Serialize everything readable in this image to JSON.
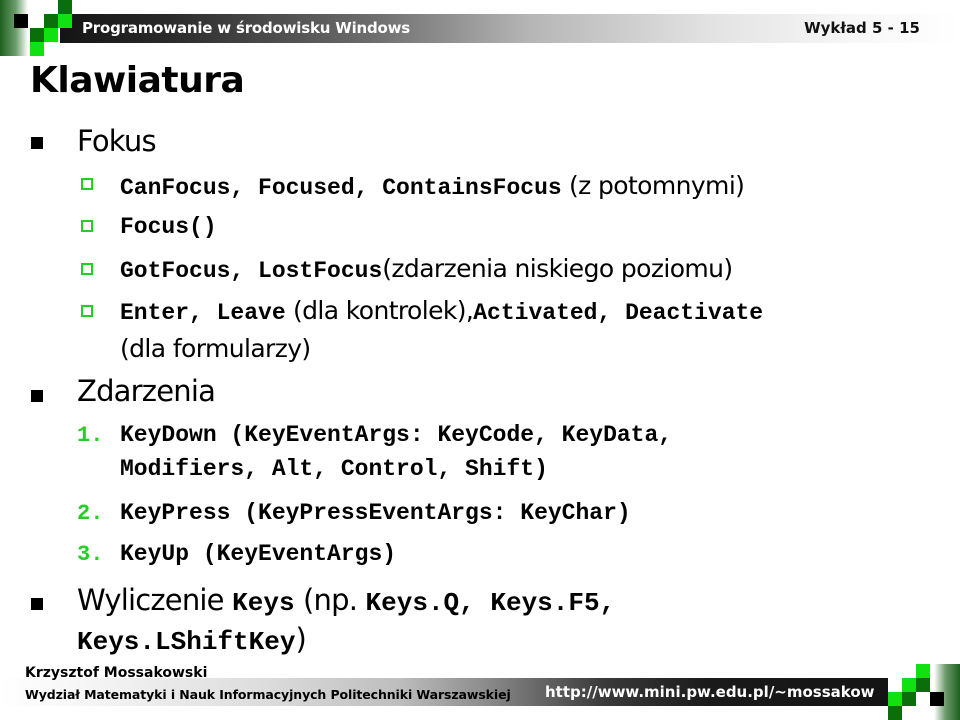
{
  "header": {
    "course_title": "Programowanie w środowisku Windows",
    "slide_ref": "Wykład 5 - 15"
  },
  "title": "Klawiatura",
  "content": {
    "focus": {
      "label": "Fokus",
      "items": [
        {
          "code": "CanFocus, Focused, ContainsFocus",
          "text": "(z potomnymi)"
        },
        {
          "code": "Focus()"
        },
        {
          "code": "GotFocus, LostFocus",
          "text": "(zdarzenia niskiego poziomu)"
        },
        {
          "code": "Enter, Leave",
          "text": "(dla kontrolek),",
          "code2": "Activated, Deactivate",
          "text2": "(dla formularzy)"
        }
      ]
    },
    "events": {
      "label": "Zdarzenia",
      "items": [
        {
          "number": "1.",
          "line1": "KeyDown (KeyEventArgs: KeyCode, KeyData,",
          "line2": "Modifiers, Alt, Control, Shift)"
        },
        {
          "number": "2.",
          "line1": "KeyPress (KeyPressEventArgs: KeyChar)"
        },
        {
          "number": "3.",
          "line1": "KeyUp (KeyEventArgs)"
        }
      ]
    },
    "enumeration": {
      "label": "Wyliczenie",
      "code": "Keys",
      "text_open": "(np.",
      "code_examples": "Keys.Q, Keys.F5,",
      "code_last": "Keys.LShiftKey",
      "text_close": ")"
    }
  },
  "footer": {
    "author": "Krzysztof Mossakowski",
    "department": "Wydział Matematyki i Nauk Informacyjnych Politechniki Warszawskiej",
    "url": "http://www.mini.pw.edu.pl/~mossakow"
  },
  "colors": {
    "bullet_green": "#22d022",
    "deco_dark_green": "#0a6e0a",
    "deco_light_green": "#11e011"
  }
}
